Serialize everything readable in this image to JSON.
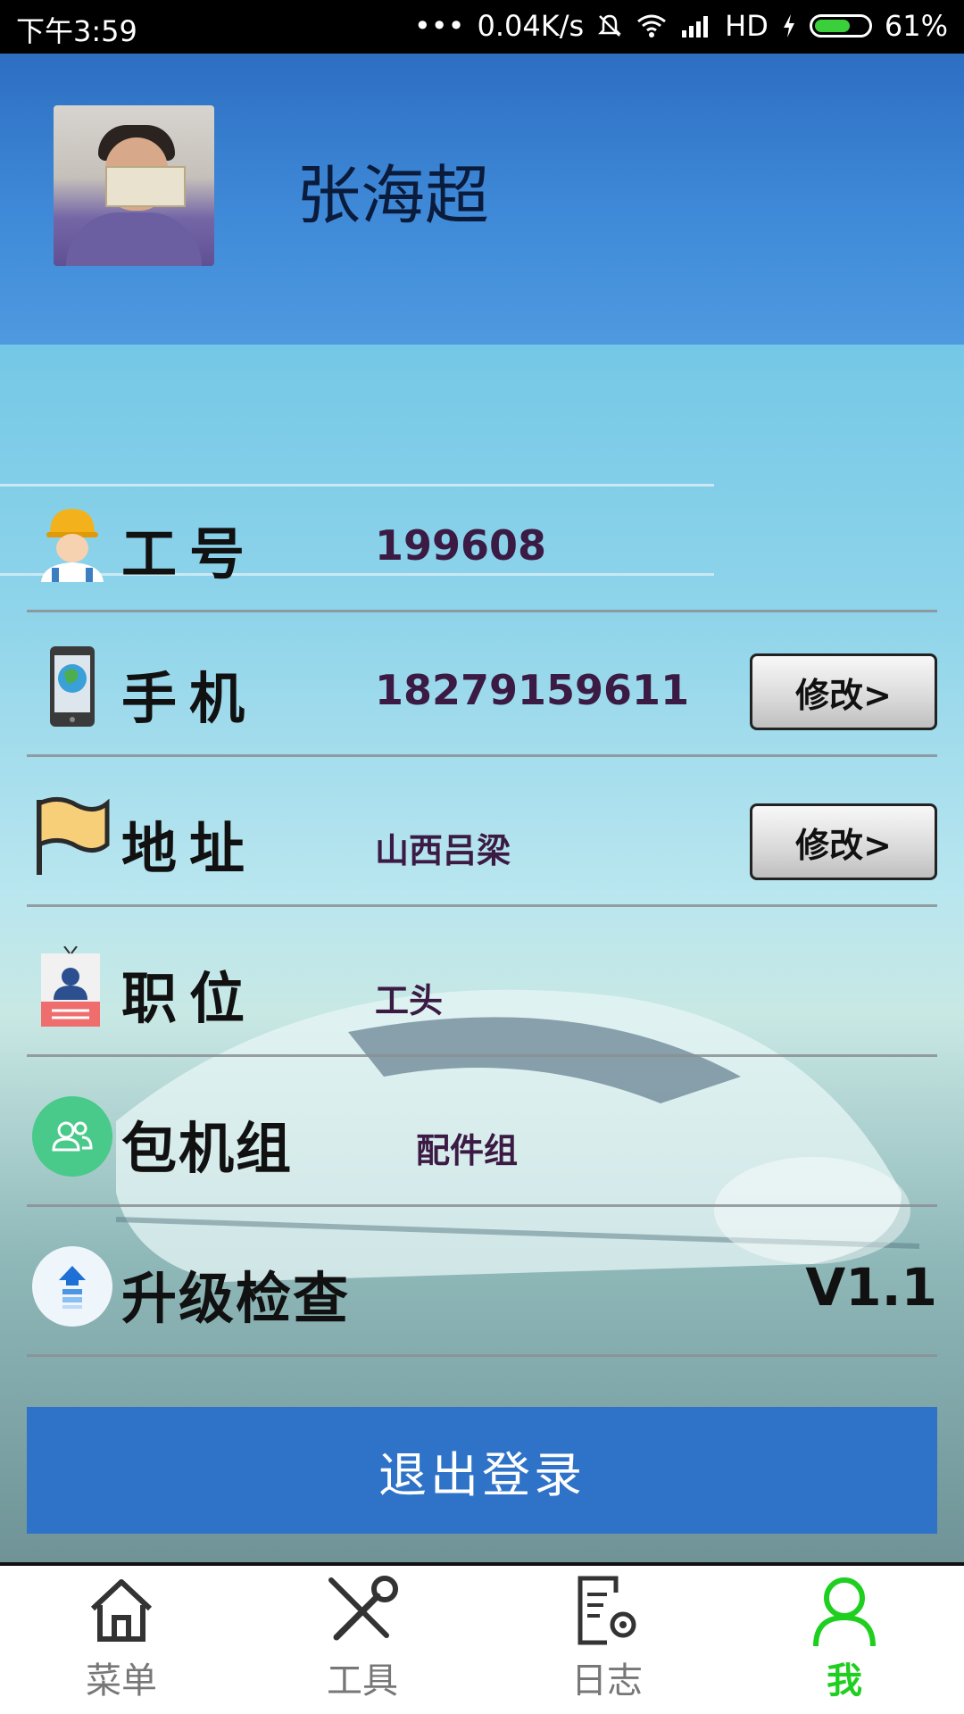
{
  "status_bar": {
    "time": "下午3:59",
    "dots": "•••",
    "network_speed": "0.04K/s",
    "hd": "HD",
    "battery": "61%",
    "icons": [
      "mute-bell-icon",
      "wifi-icon",
      "signal-icon",
      "charging-icon",
      "battery-icon"
    ]
  },
  "profile": {
    "name": "张海超"
  },
  "info": {
    "employee_id": {
      "label": "工号",
      "value": "199608"
    },
    "phone": {
      "label": "手机",
      "value": "18279159611",
      "edit_label": "修改>"
    },
    "address": {
      "label": "地址",
      "value": "山西吕梁",
      "edit_label": "修改>"
    },
    "position": {
      "label": "职位",
      "value": "工头"
    },
    "group": {
      "label": "包机组",
      "value": "配件组"
    },
    "upgrade": {
      "label": "升级检查",
      "version": "V1.1"
    }
  },
  "logout_label": "退出登录",
  "tabbar": {
    "items": [
      {
        "label": "菜单",
        "icon": "home-icon"
      },
      {
        "label": "工具",
        "icon": "tools-icon"
      },
      {
        "label": "日志",
        "icon": "log-settings-icon"
      },
      {
        "label": "我",
        "icon": "user-icon"
      }
    ],
    "active_color": "#1fcf1f"
  },
  "colors": {
    "header": "#2d6ec2",
    "logout": "#2f73c9"
  }
}
